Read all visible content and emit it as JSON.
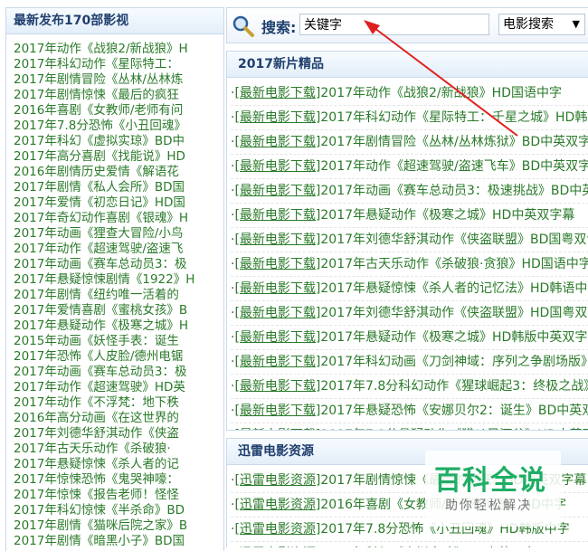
{
  "left_panel": {
    "title": "最新发布170部影视",
    "items": [
      "2017年动作《战狼2/新战狼》H",
      "2017年科幻动作《星际特工：",
      "2017年剧情冒险《丛林/丛林炼",
      "2017年剧情惊悚《最后的疯狂",
      "2016年喜剧《女教师/老师有问",
      "2017年7.8分恐怖《小丑回魂》",
      "2017年科幻《虚拟实琼》BD中",
      "2017年高分喜剧《找能说》HD",
      "2016年剧情历史爱情《解语花",
      "2017年剧情《私人会所》BD国",
      "2017年爱情《初恋日记》HD国",
      "2017年奇幻动作喜剧《银魂》H",
      "2017年动画《狸查大冒险/小鸟",
      "2017年动作《超速驾驶/盗速飞",
      "2017年动画《赛车总动员3：极",
      "2017年悬疑惊悚剧情《1922》H",
      "2017年剧情《纽约唯一活着的",
      "2017年爱情喜剧《蜜桃女孩》B",
      "2017年悬疑动作《极寒之城》H",
      "2015年动画《妖怪手表：诞生",
      "2017年恐怖《人皮脸/德州电锯",
      "2017年动画《赛车总动员3：极",
      "2017年动作《超速驾驶》HD英",
      "2017年动作《不浮梵：地下秩",
      "2016年高分动画《在这世界的",
      "2017年刘德华舒淇动作《侠盗",
      "2017年古天乐动作《杀破狼·",
      "2017年悬疑惊悚《杀人者的记",
      "2017年惊悚恐怖《鬼哭神嚎：",
      "2017年惊悚《报告老师！怪怪",
      "2017年科幻惊悚《半杀命》BD",
      "2017年剧情《猫咪后院之家》B",
      "2017年剧情《暗黑小子》BD国"
    ]
  },
  "search": {
    "label": "搜索:",
    "input_value": "关键字",
    "select_value": "电影搜索",
    "arrow_glyph": "▼"
  },
  "box_new": {
    "title": "2017新片精品",
    "items": [
      {
        "tag": "[最新电影下载]",
        "title": "2017年动作《战狼2/新战狼》HD国语中字"
      },
      {
        "tag": "[最新电影下载]",
        "title": "2017年科幻动作《星际特工：千星之城》HD韩版"
      },
      {
        "tag": "[最新电影下载]",
        "title": "2017年剧情冒险《丛林/丛林炼狱》BD中英双字"
      },
      {
        "tag": "[最新电影下载]",
        "title": "2017年动作《超速驾驶/盗速飞车》BD中英双字"
      },
      {
        "tag": "[最新电影下载]",
        "title": "2017年动画《赛车总动员3：极速挑战》BD中英"
      },
      {
        "tag": "[最新电影下载]",
        "title": "2017年悬疑动作《极寒之城》HD中英双字幕"
      },
      {
        "tag": "[最新电影下载]",
        "title": "2017年刘德华舒淇动作《侠盗联盟》BD国粤双语"
      },
      {
        "tag": "[最新电影下载]",
        "title": "2017年古天乐动作《杀破狼·贪狼》HD国语中字"
      },
      {
        "tag": "[最新电影下载]",
        "title": "2017年悬疑惊悚《杀人者的记忆法》HD韩语中字"
      },
      {
        "tag": "[最新电影下载]",
        "title": "2017年刘德华舒淇动作《侠盗联盟》HD国粤双语"
      },
      {
        "tag": "[最新电影下载]",
        "title": "2017年悬疑动作《极寒之城》HD韩版中英双字幕"
      },
      {
        "tag": "[最新电影下载]",
        "title": "2017年科幻动画《刀剑神域：序列之争剧场版》"
      },
      {
        "tag": "[最新电影下载]",
        "title": "2017年7.8分科幻动作《猩球崛起3：终极之战》"
      },
      {
        "tag": "[最新电影下载]",
        "title": "2017年悬疑恐怖《安娜贝尔2：诞生》BD中英双"
      },
      {
        "tag": "[最新电影下载]",
        "title": "2017年7.9分悬疑动作《猎凶风河谷》HD中英双"
      }
    ]
  },
  "box_thunder": {
    "title": "迅雷电影资源",
    "items": [
      {
        "tag": "[迅雷电影资源]",
        "title": "2017年剧情惊悚《最后的疯狂》BD中英双字幕"
      },
      {
        "tag": "[迅雷电影资源]",
        "title": "2016年喜剧《女教师/老师有问题》HD中字"
      },
      {
        "tag": "[迅雷电影资源]",
        "title": "2017年7.8分恐怖《小丑回魂》HD韩版中字"
      },
      {
        "tag": "[迅雷电影资源]",
        "title": "2017年科幻《虚拟实琼》BD中英双字"
      }
    ]
  },
  "watermark": {
    "main": "百科全说",
    "sub": "助你轻松解决"
  },
  "colors": {
    "link_green": "#2a7a2a",
    "title_blue": "#1f3f6e",
    "border": "#c9d9ec",
    "annotation_red": "#e02020",
    "watermark_green": "#1fae65"
  }
}
